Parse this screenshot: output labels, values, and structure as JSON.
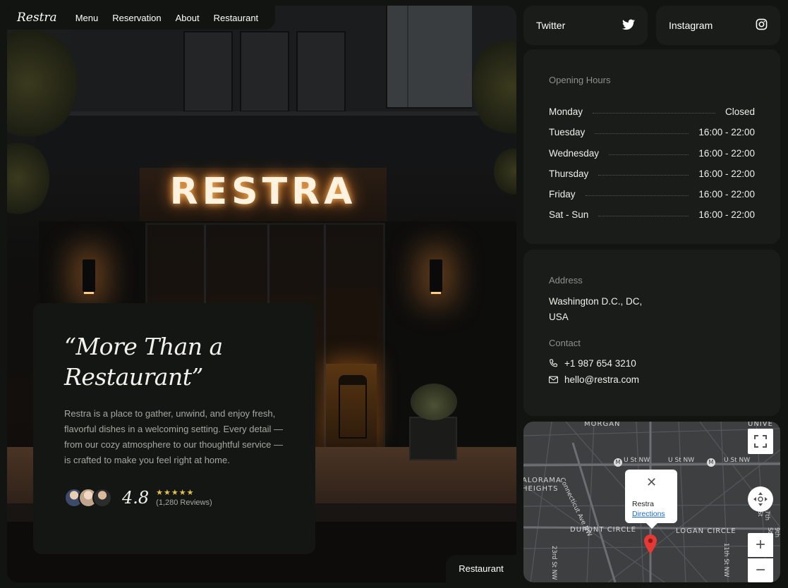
{
  "nav": {
    "logo": "Restra",
    "links": [
      "Menu",
      "Reservation",
      "About",
      "Restaurant"
    ]
  },
  "hero": {
    "sign": "RESTRA",
    "quote": "“More Than a Restaurant”",
    "description": "Restra is a place to gather, unwind, and enjoy fresh, flavorful dishes in a welcoming setting. Every detail — from our cozy atmosphere to our thoughtful service — is crafted to make you feel right at home.",
    "rating": "4.8",
    "stars": "★★★★★",
    "reviews": "(1,280 Reviews)",
    "badge": "Restaurant"
  },
  "social": {
    "twitter": "Twitter",
    "instagram": "Instagram"
  },
  "hours": {
    "title": "Opening Hours",
    "rows": [
      {
        "day": "Monday",
        "time": "Closed"
      },
      {
        "day": "Tuesday",
        "time": "16:00 - 22:00"
      },
      {
        "day": "Wednesday",
        "time": "16:00 - 22:00"
      },
      {
        "day": "Thursday",
        "time": "16:00 - 22:00"
      },
      {
        "day": "Friday",
        "time": "16:00 - 22:00"
      },
      {
        "day": "Sat - Sun",
        "time": "16:00 - 22:00"
      }
    ]
  },
  "info": {
    "address_title": "Address",
    "address_line1": "Washington D.C., DC,",
    "address_line2": "USA",
    "contact_title": "Contact",
    "phone": "+1 987 654 3210",
    "email": "hello@restra.com"
  },
  "map": {
    "labels": {
      "morgan": "MORGAN",
      "univ": "UNIVE",
      "ust1": "U St NW",
      "ust2": "U St NW",
      "ust3": "U St NW",
      "kalorama1": "ALORAMA",
      "kalorama2": "HEIGHTS",
      "connecticut": "Connecticut Ave NW",
      "dupont": "DUPONT CIRCLE",
      "logan": "LOGAN CIRCLE",
      "st23": "23rd St NW",
      "st11": "11th St NW",
      "st7": "7th St",
      "st9": "9th St",
      "metro1": "M",
      "metro2": "M"
    },
    "popup_name": "Restra",
    "popup_link": "Directions",
    "close_glyph": "✕",
    "zoom_in": "+",
    "zoom_out": "−"
  }
}
